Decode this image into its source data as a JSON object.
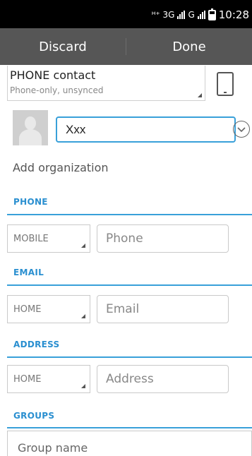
{
  "status_bar": {
    "net_prefix": "ᴴ⁺ 3G",
    "sim1": "G",
    "time": "10:28"
  },
  "action_bar": {
    "discard": "Discard",
    "done": "Done"
  },
  "account": {
    "title": "PHONE contact",
    "subtitle": "Phone-only, unsynced"
  },
  "name": {
    "value": "Xxx"
  },
  "add_organization": "Add organization",
  "phone": {
    "title": "PHONE",
    "type": "MOBILE",
    "placeholder": "Phone"
  },
  "email": {
    "title": "EMAIL",
    "type": "HOME",
    "placeholder": "Email"
  },
  "address": {
    "title": "ADDRESS",
    "type": "HOME",
    "placeholder": "Address"
  },
  "groups": {
    "title": "GROUPS",
    "placeholder": "Group name"
  }
}
